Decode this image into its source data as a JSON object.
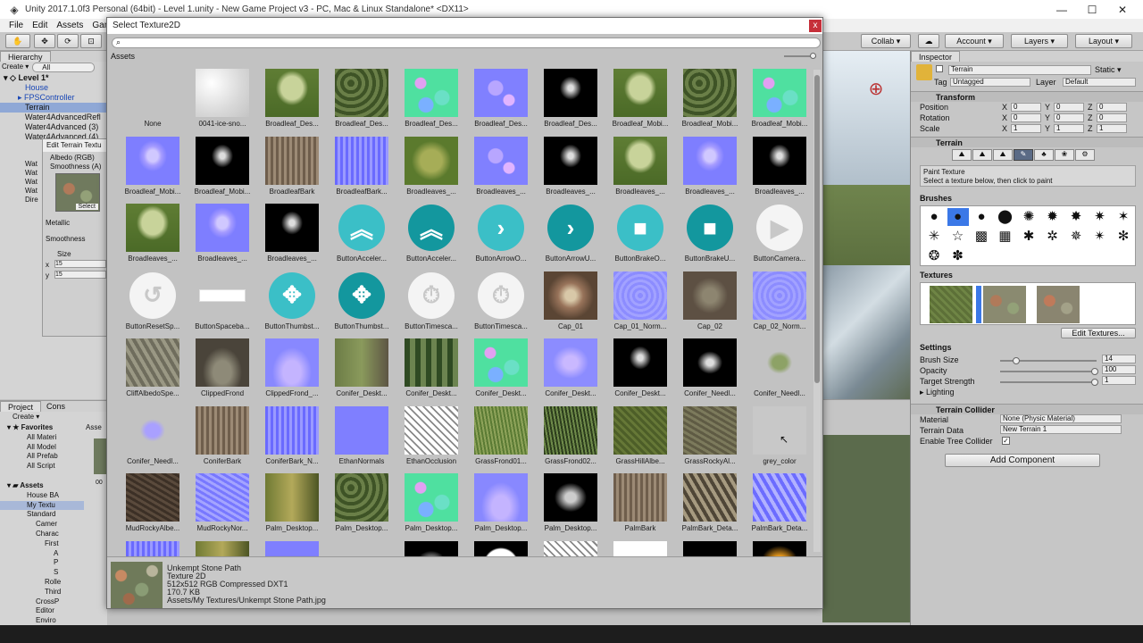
{
  "window": {
    "title": "Unity 2017.1.0f3 Personal (64bit) - Level 1.unity - New Game Project v3 - PC, Mac & Linux Standalone* <DX11>",
    "logo": "unity-logo"
  },
  "menu": [
    "File",
    "Edit",
    "Assets",
    "Game"
  ],
  "toolbar": {
    "collab": "Collab ▾",
    "account": "Account ▾",
    "layers": "Layers ▾",
    "layout": "Layout ▾"
  },
  "hierarchy": {
    "tab": "Hierarchy",
    "create": "Create ▾",
    "search": "All",
    "scene": "Level 1*",
    "rows": [
      "House",
      "FPSController",
      "Terrain",
      "Water4AdvancedRefl",
      "Water4Advanced (3)",
      "Water4Advanced (4)",
      "Wat",
      "Wat",
      "Wat",
      "Wat",
      "Dire"
    ]
  },
  "terrain_popup": {
    "title": "Edit Terrain Textu",
    "albedo": "Albedo (RGB)",
    "smooth": "Smoothness (A)",
    "select": "Select",
    "metallic": "Metallic",
    "smoothness": "Smoothness",
    "size": "Size",
    "x": "15",
    "y": "15"
  },
  "project": {
    "tab": "Project",
    "console": "Cons",
    "create": "Create ▾",
    "favorites": "Favorites",
    "fav_items": [
      "All Materi",
      "All Model",
      "All Prefab",
      "All Script"
    ],
    "assets": "Assets",
    "asset_items": [
      "House BA",
      "My Textu",
      "Standard",
      "Camer",
      "Charac",
      "First",
      "A",
      "P",
      "S",
      "Rolle",
      "Third",
      "CrossP",
      "Editor",
      "Enviro"
    ],
    "asset_tab": "Asse",
    "asset_thumb": "00"
  },
  "dialog": {
    "title": "Select Texture2D",
    "close": "x",
    "tab": "Assets",
    "items": [
      {
        "label": "None",
        "kind": "none"
      },
      {
        "label": "0041-ice-sno...",
        "kind": "snow"
      },
      {
        "label": "Broadleaf_Des...",
        "kind": "tree-green"
      },
      {
        "label": "Broadleaf_Des...",
        "kind": "leaves-dark"
      },
      {
        "label": "Broadleaf_Des...",
        "kind": "leaves-color"
      },
      {
        "label": "Broadleaf_Des...",
        "kind": "leaves-normal"
      },
      {
        "label": "Broadleaf_Des...",
        "kind": "tree-black"
      },
      {
        "label": "Broadleaf_Mobi...",
        "kind": "tree-green"
      },
      {
        "label": "Broadleaf_Mobi...",
        "kind": "leaves-dark"
      },
      {
        "label": "Broadleaf_Mobi...",
        "kind": "leaves-color"
      },
      {
        "label": "Broadleaf_Mobi...",
        "kind": "tree-normal"
      },
      {
        "label": "Broadleaf_Mobi...",
        "kind": "tree-black"
      },
      {
        "label": "BroadleafBark",
        "kind": "bark"
      },
      {
        "label": "BroadleafBark...",
        "kind": "bark-normal"
      },
      {
        "label": "Broadleaves_...",
        "kind": "bush-green"
      },
      {
        "label": "Broadleaves_...",
        "kind": "leaves-normal"
      },
      {
        "label": "Broadleaves_...",
        "kind": "tree-black"
      },
      {
        "label": "Broadleaves_...",
        "kind": "tree-green"
      },
      {
        "label": "Broadleaves_...",
        "kind": "tree-normal"
      },
      {
        "label": "Broadleaves_...",
        "kind": "tree-black"
      },
      {
        "label": "Broadleaves_...",
        "kind": "tree-green"
      },
      {
        "label": "Broadleaves_...",
        "kind": "tree-normal"
      },
      {
        "label": "Broadleaves_...",
        "kind": "tree-black"
      },
      {
        "label": "ButtonAcceler...",
        "kind": "btn-teal",
        "glyph": "︽"
      },
      {
        "label": "ButtonAcceler...",
        "kind": "btn-dteal",
        "glyph": "︽"
      },
      {
        "label": "ButtonArrowO...",
        "kind": "btn-teal",
        "glyph": "›"
      },
      {
        "label": "ButtonArrowU...",
        "kind": "btn-dteal",
        "glyph": "›"
      },
      {
        "label": "ButtonBrakeO...",
        "kind": "btn-teal",
        "glyph": "■"
      },
      {
        "label": "ButtonBrakeU...",
        "kind": "btn-dteal",
        "glyph": "■"
      },
      {
        "label": "ButtonCamera...",
        "kind": "btn-white",
        "glyph": "▶"
      },
      {
        "label": "ButtonResetSp...",
        "kind": "btn-ring",
        "glyph": "↺"
      },
      {
        "label": "ButtonSpaceba...",
        "kind": "spacebar"
      },
      {
        "label": "ButtonThumbst...",
        "kind": "btn-teal",
        "glyph": "✥"
      },
      {
        "label": "ButtonThumbst...",
        "kind": "btn-dteal",
        "glyph": "✥"
      },
      {
        "label": "ButtonTimesca...",
        "kind": "btn-ring",
        "glyph": "⏱"
      },
      {
        "label": "ButtonTimesca...",
        "kind": "btn-ring",
        "glyph": "⏱"
      },
      {
        "label": "Cap_01",
        "kind": "cap"
      },
      {
        "label": "Cap_01_Norm...",
        "kind": "cap-normal"
      },
      {
        "label": "Cap_02",
        "kind": "cap2"
      },
      {
        "label": "Cap_02_Norm...",
        "kind": "cap-normal"
      },
      {
        "label": "CliffAlbedoSpe...",
        "kind": "cliff"
      },
      {
        "label": "ClippedFrond",
        "kind": "frond"
      },
      {
        "label": "ClippedFrond_...",
        "kind": "frond-normal"
      },
      {
        "label": "Conifer_Deskt...",
        "kind": "conifer"
      },
      {
        "label": "Conifer_Deskt...",
        "kind": "conifer-dark"
      },
      {
        "label": "Conifer_Deskt...",
        "kind": "leaves-color"
      },
      {
        "label": "Conifer_Deskt...",
        "kind": "conifer-normal"
      },
      {
        "label": "Conifer_Deskt...",
        "kind": "tree-black"
      },
      {
        "label": "Conifer_Needl...",
        "kind": "needle-black"
      },
      {
        "label": "Conifer_Needl...",
        "kind": "needle-green"
      },
      {
        "label": "Conifer_Needl...",
        "kind": "needle-normal"
      },
      {
        "label": "ConiferBark",
        "kind": "bark"
      },
      {
        "label": "ConiferBark_N...",
        "kind": "bark-normal"
      },
      {
        "label": "EthanNormals",
        "kind": "normal-flat"
      },
      {
        "label": "EthanOcclusion",
        "kind": "occlusion"
      },
      {
        "label": "GrassFrond01...",
        "kind": "grass"
      },
      {
        "label": "GrassFrond02...",
        "kind": "grass-dark"
      },
      {
        "label": "GrassHillAlbe...",
        "kind": "grass-hill"
      },
      {
        "label": "GrassRockyAl...",
        "kind": "grass-rocky"
      },
      {
        "label": "grey_color",
        "kind": "grey"
      },
      {
        "label": "MudRockyAlbe...",
        "kind": "mud"
      },
      {
        "label": "MudRockyNor...",
        "kind": "mud-normal"
      },
      {
        "label": "Palm_Desktop...",
        "kind": "palm"
      },
      {
        "label": "Palm_Desktop...",
        "kind": "leaves-dark"
      },
      {
        "label": "Palm_Desktop...",
        "kind": "leaves-color"
      },
      {
        "label": "Palm_Desktop...",
        "kind": "frond-normal"
      },
      {
        "label": "Palm_Desktop...",
        "kind": "palm-black"
      },
      {
        "label": "PalmBark",
        "kind": "bark"
      },
      {
        "label": "PalmBark_Deta...",
        "kind": "palmbark"
      },
      {
        "label": "PalmBark_Deta...",
        "kind": "palmbark-normal"
      },
      {
        "label": "",
        "kind": "bark-normal"
      },
      {
        "label": "",
        "kind": "palm"
      },
      {
        "label": "",
        "kind": "normal-flat"
      },
      {
        "label": "",
        "kind": "none"
      },
      {
        "label": "",
        "kind": "palm-black"
      },
      {
        "label": "",
        "kind": "hexagon"
      },
      {
        "label": "",
        "kind": "occlusion"
      },
      {
        "label": "",
        "kind": "white"
      },
      {
        "label": "",
        "kind": "spark"
      },
      {
        "label": "",
        "kind": "fire"
      },
      {
        "label": "",
        "kind": "spark"
      }
    ],
    "preview": {
      "name": "Unkempt Stone Path",
      "type": "Texture 2D",
      "format": "512x512  RGB Compressed DXT1",
      "size": "170.7 KB",
      "path": "Assets/My Textures/Unkempt Stone Path.jpg"
    }
  },
  "inspector": {
    "tab": "Inspector",
    "name": "Terrain",
    "static": "Static ▾",
    "tag_label": "Tag",
    "tag": "Untagged",
    "layer_label": "Layer",
    "layer": "Default",
    "transform": "Transform",
    "position": "Position",
    "rotation": "Rotation",
    "scale": "Scale",
    "pos": [
      "0",
      "0",
      "0"
    ],
    "rot": [
      "0",
      "0",
      "0"
    ],
    "scl": [
      "1",
      "1",
      "1"
    ],
    "terrain": "Terrain",
    "paint_title": "Paint Texture",
    "paint_hint": "Select a texture below, then click to paint",
    "brushes": "Brushes",
    "textures": "Textures",
    "edit_textures": "Edit Textures...",
    "settings": "Settings",
    "brush_size": "Brush Size",
    "brush_size_val": "14",
    "opacity": "Opacity",
    "opacity_val": "100",
    "target": "Target Strength",
    "target_val": "1",
    "lighting": "Lighting",
    "collider": "Terrain Collider",
    "material": "Material",
    "material_val": "None (Physic Material)",
    "terrain_data": "Terrain Data",
    "terrain_data_val": "New Terrain 1",
    "tree_collider": "Enable Tree Collider",
    "add_component": "Add Component"
  },
  "axis": {
    "x": "X",
    "y": "Y",
    "z": "Z"
  }
}
